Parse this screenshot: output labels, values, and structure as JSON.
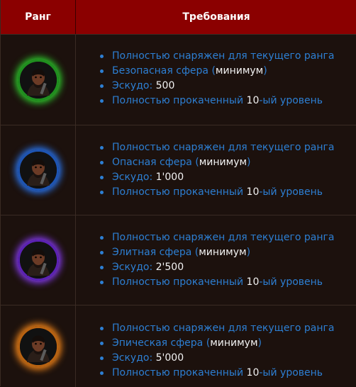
{
  "header": {
    "rank": "Ранг",
    "requirements": "Требования"
  },
  "colors": {
    "header_bg": "#8b0000",
    "link": "#2d7fd3",
    "text": "#f2f2f2",
    "rank_glows": [
      "#3ee83e",
      "#3b8cff",
      "#9b4dff",
      "#ff9a1f"
    ]
  },
  "rows": [
    {
      "icon": "rank-portrait-icon",
      "items": [
        {
          "a": "Полностью снаряжен для текущего ранга",
          "b": ""
        },
        {
          "a": "Безопасная сфера (",
          "b": "минимум",
          "c": ")"
        },
        {
          "a": "Эскудо: ",
          "b": "500"
        },
        {
          "a": "Полностью прокаченный ",
          "b": "10",
          "c": "-ый уровень"
        }
      ]
    },
    {
      "icon": "rank-portrait-icon",
      "items": [
        {
          "a": "Полностью снаряжен для текущего ранга",
          "b": ""
        },
        {
          "a": "Опасная сфера (",
          "b": "минимум",
          "c": ")"
        },
        {
          "a": "Эскудо: ",
          "b": "1'000"
        },
        {
          "a": "Полностью прокаченный ",
          "b": "10",
          "c": "-ый уровень"
        }
      ]
    },
    {
      "icon": "rank-portrait-icon",
      "items": [
        {
          "a": "Полностью снаряжен для текущего ранга",
          "b": ""
        },
        {
          "a": "Элитная сфера (",
          "b": "минимум",
          "c": ")"
        },
        {
          "a": "Эскудо: ",
          "b": "2'500"
        },
        {
          "a": "Полностью прокаченный ",
          "b": "10",
          "c": "-ый уровень"
        }
      ]
    },
    {
      "icon": "rank-portrait-icon",
      "items": [
        {
          "a": "Полностью снаряжен для текущего ранга",
          "b": ""
        },
        {
          "a": "Эпическая сфера (",
          "b": "минимум",
          "c": ")"
        },
        {
          "a": "Эскудо: ",
          "b": "5'000"
        },
        {
          "a": "Полностью прокаченный ",
          "b": "10",
          "c": "-ый уровень"
        }
      ]
    }
  ]
}
